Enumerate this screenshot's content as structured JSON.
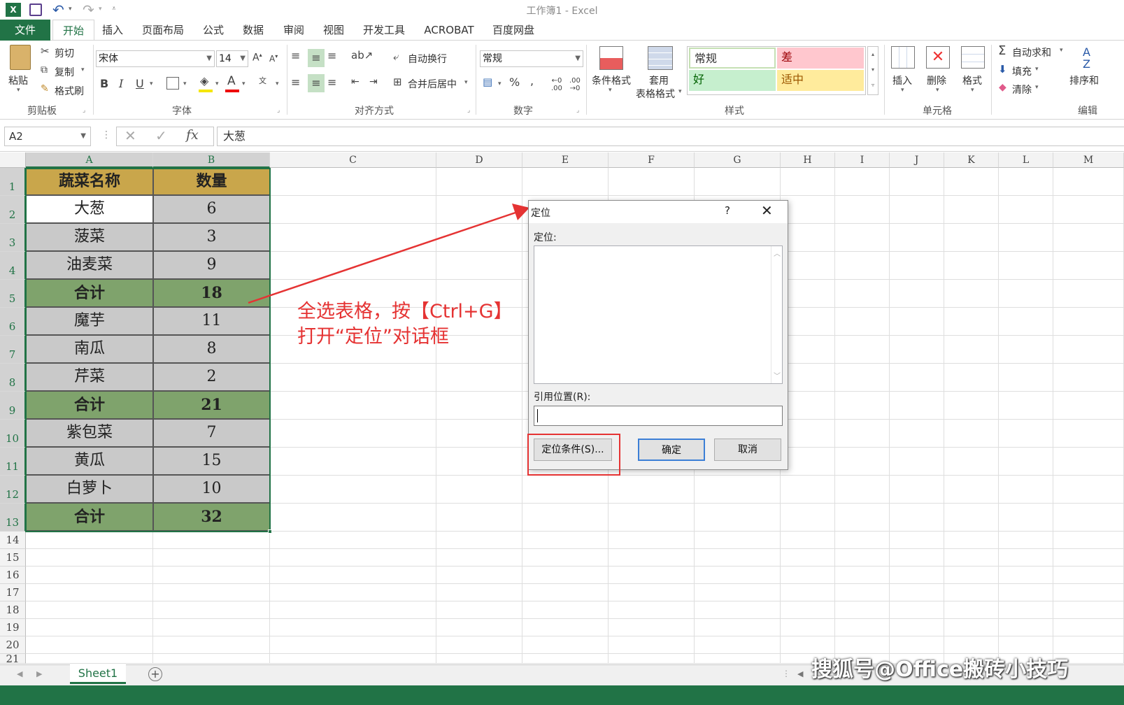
{
  "window": {
    "title": "工作簿1 - Excel"
  },
  "menu": {
    "tabs": [
      "文件",
      "开始",
      "插入",
      "页面布局",
      "公式",
      "数据",
      "审阅",
      "视图",
      "开发工具",
      "ACROBAT",
      "百度网盘"
    ]
  },
  "ribbon": {
    "clipboard": {
      "paste": "粘贴",
      "cut": "剪切",
      "copy": "复制",
      "format_painter": "格式刷",
      "label": "剪贴板"
    },
    "font": {
      "name": "宋体",
      "size": "14",
      "label": "字体"
    },
    "align": {
      "wrap": "自动换行",
      "merge": "合并后居中",
      "label": "对齐方式"
    },
    "number": {
      "format": "常规",
      "label": "数字"
    },
    "styles": {
      "cond": "条件格式",
      "table_fmt_1": "套用",
      "table_fmt_2": "表格格式",
      "normal": "常规",
      "bad": "差",
      "good": "好",
      "neutral": "适中",
      "label": "样式"
    },
    "cells": {
      "insert": "插入",
      "delete": "删除",
      "format": "格式",
      "label": "单元格"
    },
    "editing": {
      "autosum": "自动求和",
      "fill": "填充",
      "clear": "清除",
      "sort": "排序和",
      "label": "编辑"
    }
  },
  "formula": {
    "namebox": "A2",
    "value": "大葱"
  },
  "columns": [
    "A",
    "B",
    "C",
    "D",
    "E",
    "F",
    "G",
    "H",
    "I",
    "J",
    "K",
    "L",
    "M"
  ],
  "rows": [
    "1",
    "2",
    "3",
    "4",
    "5",
    "6",
    "7",
    "8",
    "9",
    "10",
    "11",
    "12",
    "13",
    "14",
    "15",
    "16",
    "17",
    "18",
    "19",
    "20",
    "21"
  ],
  "table": {
    "header": [
      "蔬菜名称",
      "数量"
    ],
    "rows": [
      [
        "大葱",
        "6"
      ],
      [
        "菠菜",
        "3"
      ],
      [
        "油麦菜",
        "9"
      ],
      [
        "合计",
        "18"
      ],
      [
        "魔芋",
        "11"
      ],
      [
        "南瓜",
        "8"
      ],
      [
        "芹菜",
        "2"
      ],
      [
        "合计",
        "21"
      ],
      [
        "紫包菜",
        "7"
      ],
      [
        "黄瓜",
        "15"
      ],
      [
        "白萝卜",
        "10"
      ],
      [
        "合计",
        "32"
      ]
    ]
  },
  "dialog": {
    "title": "定位",
    "help": "?",
    "goto_label": "定位:",
    "reference_label": "引用位置(R):",
    "special_button": "定位条件(S)...",
    "ok": "确定",
    "cancel": "取消"
  },
  "annotation": {
    "line1": "全选表格，按【Ctrl+G】",
    "line2": "打开“定位”对话框"
  },
  "sheets": {
    "active": "Sheet1"
  },
  "watermark": "搜狐号@Office搬砖小技巧",
  "colors": {
    "excel_green": "#217346",
    "header_fill": "#c9a64b",
    "subtotal_fill": "#7fa36c",
    "body_fill": "#c9c9c9",
    "highlight": "#e53333"
  }
}
